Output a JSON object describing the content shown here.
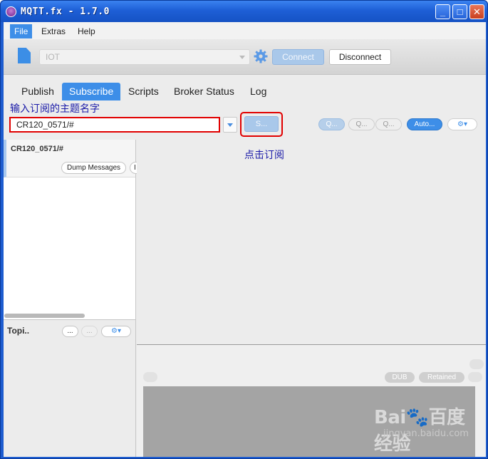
{
  "window": {
    "title": "MQTT.fx - 1.7.0",
    "controls": {
      "minimize": "_",
      "maximize": "□",
      "close": "✕"
    }
  },
  "menubar": {
    "items": [
      "File",
      "Extras",
      "Help"
    ]
  },
  "connection": {
    "profile": "IOT",
    "connect_label": "Connect",
    "disconnect_label": "Disconnect"
  },
  "tabs": [
    "Publish",
    "Subscribe",
    "Scripts",
    "Broker Status",
    "Log"
  ],
  "annotations": {
    "topic_hint": "输入订阅的主题名字",
    "click_hint": "点击订阅"
  },
  "subscribe": {
    "topic_value": "CR120_0571/#",
    "subscribe_label": "S...",
    "qos_labels": [
      "Q...",
      "Q...",
      "Q..."
    ],
    "auto_label": "Auto...",
    "options_label": "⚙▾"
  },
  "subscriptions": [
    {
      "topic": "CR120_0571/#",
      "dump_label": "Dump Messages",
      "more_label": "I"
    }
  ],
  "topics_panel": {
    "label": "Topi..",
    "btn1": "...",
    "btn2": "...",
    "options_label": "⚙▾"
  },
  "detail": {
    "dub_label": "DUB",
    "retained_label": "Retained"
  },
  "watermark": {
    "main": "Bai🐾百度 经验",
    "sub": "jingyan.baidu.com"
  }
}
